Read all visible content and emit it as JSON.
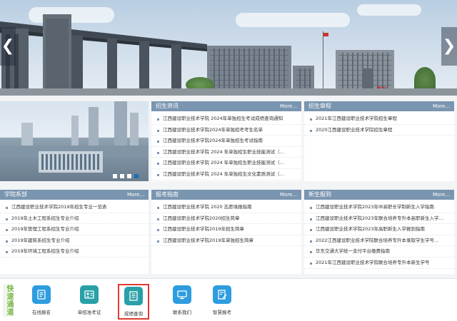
{
  "hero": {
    "prev_glyph": "❮",
    "next_glyph": "❯",
    "sign_text": "职业"
  },
  "campus_slider": {
    "dot_count": 4,
    "active_dot": 4
  },
  "sections": {
    "admission_news": {
      "title": "招生资讯",
      "more": "More...",
      "items": [
        "江西建设职业技术学院 2024年单独招生考试成绩查询通知",
        "江西建设职业技术学院2024年单独招考考生名单",
        "江西建设职业技术学院2024年单独招生考试指南",
        "江西建设职业技术学院 2024 年单独招生职业技能测试（…",
        "江西建设职业技术学院 2024 年单独招生职业技能测试（…",
        "江西建设职业技术学院 2024 年单独招生文化素质测试（…"
      ]
    },
    "admission_charter": {
      "title": "招生章程",
      "more": "More...",
      "items": [
        "2021年江西建设职业技术学院招生章程",
        "2020江西建设职业技术学院招生章程"
      ]
    },
    "departments": {
      "title": "学院系部",
      "more": "More...",
      "items": [
        "江西建设职业技术学院2019年招生专业一览表",
        "2019年土木工程系招生专业介绍",
        "2019年管理工程系招生专业介绍",
        "2019年建筑系招生专业介绍",
        "2019年环境工程系招生专业介绍"
      ]
    },
    "exam_guide": {
      "title": "报考指南",
      "more": "More...",
      "items": [
        "江西建设职业技术学院 2020 志愿填报指南",
        "江西建设职业技术学院2020招生简章",
        "江西建设职业技术学院2019年招生简章",
        "江西建设职业技术学院2019年单独招生简章"
      ]
    },
    "new_students": {
      "title": "新生报到",
      "more": "More...",
      "items": [
        "江西建设职业技术学院2023年中高职长学制新生入学指南",
        "江西建设职业技术学院2023年联合培养专升本高职新生入学…",
        "江西建设职业技术学院2023年高职新生入学报到指南",
        "2022江西建设职业技术学院联合培养专升本录取学生学号…",
        "华东交通大学统一支付平台缴费指南",
        "2021年江西建设职业技术学院联合培养专升本新生学号"
      ]
    }
  },
  "quick_links": {
    "label": "快速通道",
    "items": [
      {
        "name": "在线报名",
        "icon": "form-icon"
      },
      {
        "name": "单招准考证",
        "icon": "admission-ticket-icon"
      },
      {
        "name": "成绩查询",
        "icon": "score-query-icon"
      },
      {
        "name": "联系我们",
        "icon": "monitor-icon"
      },
      {
        "name": "智慧报考",
        "icon": "edit-document-icon"
      }
    ]
  },
  "colors": {
    "section_header": "#7a95b0",
    "quick_icon": "#2e9de0",
    "quick_icon_teal": "#29a0a8",
    "highlight_border": "#e03b2e",
    "quick_label": "#7ab648"
  }
}
